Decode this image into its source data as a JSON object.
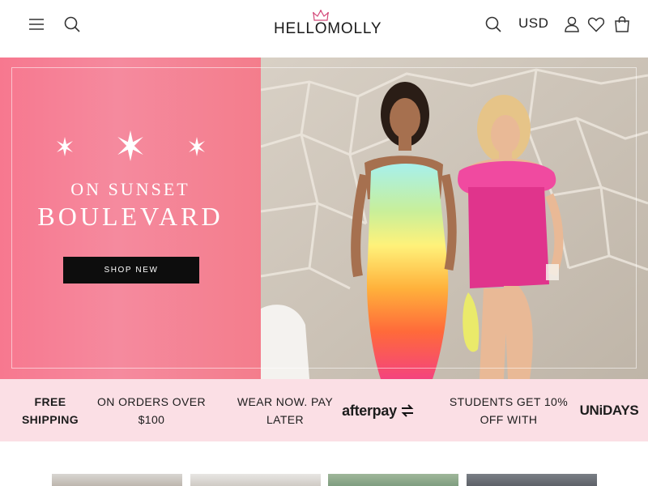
{
  "header": {
    "logo_text": "HELLOMOLLY",
    "currency": "USD",
    "icons": {
      "menu": "menu-icon",
      "search": "search-icon",
      "account": "user-icon",
      "wishlist": "heart-icon",
      "bag": "shopping-bag-icon"
    }
  },
  "hero": {
    "subtitle": "ON SUNSET",
    "title": "BOULEVARD",
    "cta_label": "SHOP NEW",
    "colors": {
      "left_bg": "#f7788f",
      "button": "#0d0d0d",
      "dress_pink": "#e0348c"
    }
  },
  "promo": {
    "free_shipping": "FREE SHIPPING",
    "orders_over": "ON ORDERS OVER $100",
    "wear_now": "WEAR NOW. PAY LATER",
    "afterpay": "afterpay",
    "students": "STUDENTS GET 10% OFF WITH",
    "unidays": "UNiDAYS",
    "background": "#fbdfe5"
  }
}
